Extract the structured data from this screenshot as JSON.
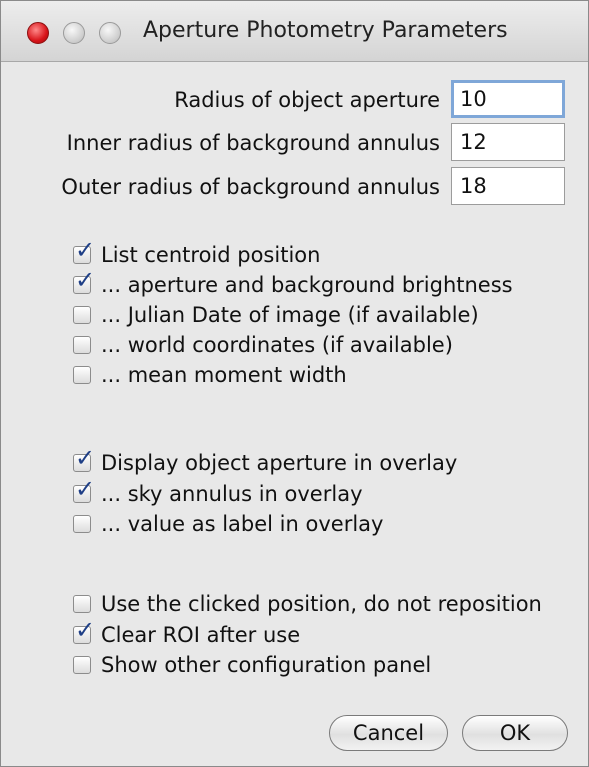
{
  "window": {
    "title": "Aperture Photometry Parameters"
  },
  "fields": [
    {
      "label": "Radius of object aperture",
      "value": "10"
    },
    {
      "label": "Inner radius of background annulus",
      "value": "12"
    },
    {
      "label": "Outer radius of background annulus",
      "value": "18"
    }
  ],
  "measure_group": [
    {
      "label": "List centroid position",
      "checked": true
    },
    {
      "label": "... aperture and background brightness",
      "checked": true
    },
    {
      "label": "... Julian Date of image (if available)",
      "checked": false
    },
    {
      "label": "... world coordinates (if available)",
      "checked": false
    },
    {
      "label": "... mean moment width",
      "checked": false
    }
  ],
  "overlay_group": [
    {
      "label": "Display object aperture in overlay",
      "checked": true
    },
    {
      "label": "... sky annulus in overlay",
      "checked": true
    },
    {
      "label": "... value as label in overlay",
      "checked": false
    }
  ],
  "options_group": [
    {
      "label": "Use the clicked position, do not reposition",
      "checked": false
    },
    {
      "label": "Clear ROI after use",
      "checked": true
    },
    {
      "label": "Show other configuration panel",
      "checked": false
    }
  ],
  "buttons": {
    "cancel": "Cancel",
    "ok": "OK"
  },
  "colors": {
    "checkmark": "#1f3f86",
    "focus_ring": "#7fa7d8",
    "close_light": "#d8141a"
  }
}
